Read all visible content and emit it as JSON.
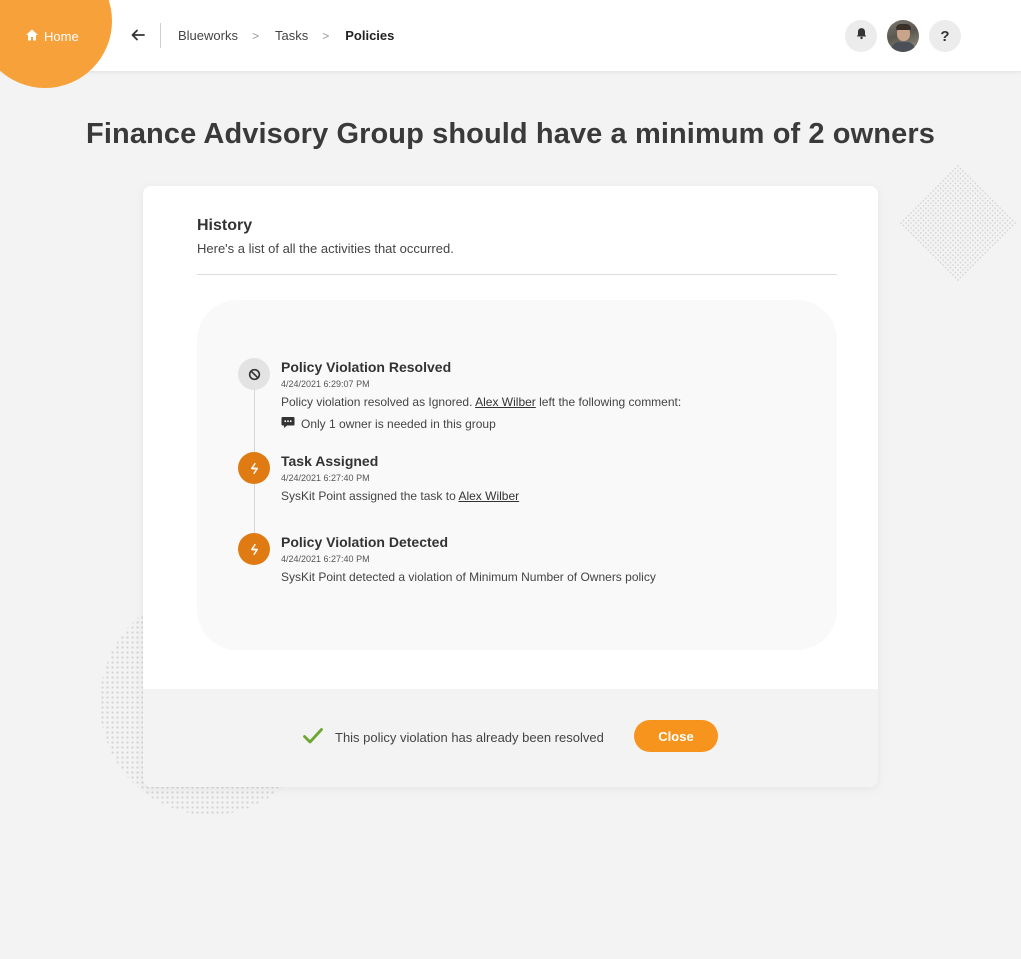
{
  "nav": {
    "home_label": "Home",
    "breadcrumbs": [
      "Blueworks",
      "Tasks",
      "Policies"
    ],
    "separator": ">",
    "help_label": "?"
  },
  "page": {
    "title": "Finance Advisory Group should have a minimum of 2 owners"
  },
  "history": {
    "title": "History",
    "subtitle": "Here's a list of all the activities that occurred.",
    "events": [
      {
        "icon": "ban-icon",
        "title": "Policy Violation Resolved",
        "date": "4/24/2021 6:29:07 PM",
        "desc_before": "Policy violation resolved as Ignored. ",
        "desc_link": "Alex Wilber",
        "desc_after": " left the following comment:",
        "comment": "Only 1 owner is needed in this group"
      },
      {
        "icon": "syskit-icon",
        "title": "Task Assigned",
        "date": "4/24/2021 6:27:40 PM",
        "desc_before": "SysKit Point assigned the task to ",
        "desc_link": "Alex Wilber",
        "desc_after": ""
      },
      {
        "icon": "syskit-icon",
        "title": "Policy Violation Detected",
        "date": "4/24/2021 6:27:40 PM",
        "desc_before": "SysKit Point detected a violation of Minimum Number of Owners policy"
      }
    ]
  },
  "footer": {
    "status_text": "This policy violation has already been resolved",
    "close_label": "Close"
  },
  "colors": {
    "accent": "#f7941d",
    "home_blob": "#f7a13a",
    "event_orange": "#e07b14",
    "check_green": "#6aa832"
  }
}
